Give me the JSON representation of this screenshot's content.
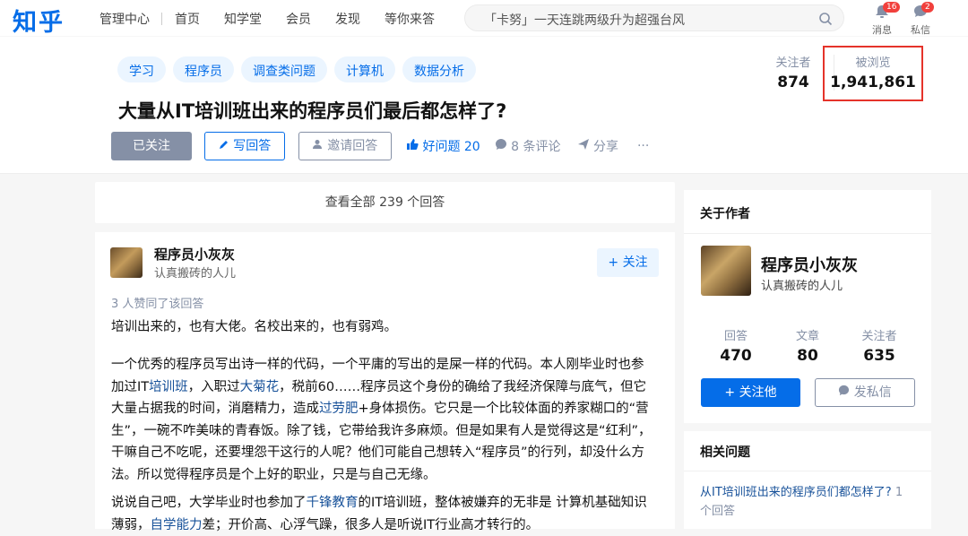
{
  "header": {
    "logo": "知乎",
    "nav": [
      "管理中心",
      "首页",
      "知学堂",
      "会员",
      "发现",
      "等你来答"
    ],
    "search_value": "「卡努」一天连跳两级升为超强台风",
    "messages_label": "消息",
    "messages_count": "16",
    "dm_label": "私信",
    "dm_count": "2"
  },
  "question": {
    "tags": [
      "学习",
      "程序员",
      "调查类问题",
      "计算机",
      "数据分析"
    ],
    "title": "大量从IT培训班出来的程序员们最后都怎样了?",
    "followed_label": "已关注",
    "write_label": "写回答",
    "invite_label": "邀请回答",
    "good_question_label": "好问题 20",
    "comments_label": "8 条评论",
    "share_label": "分享",
    "more_label": "···",
    "followers_label": "关注者",
    "followers_value": "874",
    "views_label": "被浏览",
    "views_value": "1,941,861"
  },
  "main": {
    "view_all": "查看全部 239 个回答",
    "answer": {
      "author": "程序员小灰灰",
      "headline": "认真搬砖的人儿",
      "follow_label": "+ 关注",
      "votes": "3 人赞同了该回答",
      "p1": "培训出来的，也有大佬。名校出来的，也有弱鸡。",
      "p2_a": "一个优秀的程序员写出诗一样的代码，一个平庸的写出的是屎一样的代码。本人刚毕业时也参加过IT",
      "p2_kw1": "培训班",
      "p2_b": "，入职过",
      "p2_kw2": "大菊花",
      "p2_c": "，税前60……程序员这个身份的确给了我经济保障与底气，但它大量占据我的时间，消磨精力，造成",
      "p2_kw3": "过劳肥",
      "p2_d": "+身体损伤。它只是一个比较体面的养家糊口的“营生”，一碗不咋美味的青春饭。除了钱，它带给我许多麻烦。但是如果有人是觉得这是“红利”，干嘛自己不吃呢，还要埋怨干这行的人呢？他们可能自己想转入“程序员”的行列，却没什么方法。所以觉得程序员是个上好的职业，只是与自己无缘。",
      "p3_a": "说说自己吧，大学毕业时也参加了",
      "p3_kw1": "千锋教育",
      "p3_b": "的IT培训班，整体被嫌弃的无非是 计算机基础知识薄弱，",
      "p3_kw2": "自学能力",
      "p3_c": "差；开价高、心浮气躁，很多人是听说IT行业高才转行的。"
    }
  },
  "sidebar": {
    "about_title": "关于作者",
    "name": "程序员小灰灰",
    "headline": "认真搬砖的人儿",
    "answers_label": "回答",
    "answers_value": "470",
    "articles_label": "文章",
    "articles_value": "80",
    "followers_label": "关注者",
    "followers_value": "635",
    "follow_label": "+ 关注他",
    "dm_label": "发私信",
    "related_title": "相关问题",
    "related_question": "从IT培训班出来的程序员们都怎样了?",
    "related_count": "1 个回答"
  },
  "colors": {
    "brand": "#056de8",
    "highlight_border": "#e5332a",
    "link": "#175199"
  }
}
